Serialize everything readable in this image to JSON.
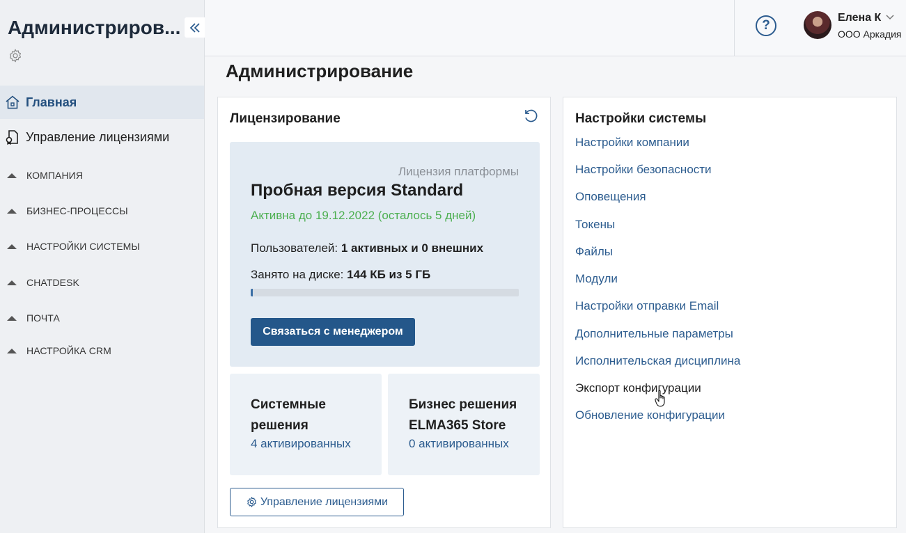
{
  "sidebar": {
    "title": "Администриров...",
    "nav": [
      {
        "label": "Главная",
        "icon": "home-icon",
        "active": true
      },
      {
        "label": "Управление лицензиями",
        "icon": "license-icon",
        "active": false
      }
    ],
    "sections": [
      {
        "label": "КОМПАНИЯ"
      },
      {
        "label": "БИЗНЕС-ПРОЦЕССЫ"
      },
      {
        "label": "НАСТРОЙКИ СИСТЕМЫ"
      },
      {
        "label": "CHATDESK"
      },
      {
        "label": "ПОЧТА"
      },
      {
        "label": "НАСТРОЙКА CRM"
      }
    ]
  },
  "header": {
    "help_glyph": "?",
    "user": {
      "name": "Елена К",
      "org": "ООО Аркадия"
    }
  },
  "main": {
    "page_title": "Администрирование",
    "licensing": {
      "title": "Лицензирование",
      "platform_label": "Лицензия платформы",
      "plan": "Пробная версия Standard",
      "active_until": "Активна до 19.12.2022 (осталось 5 дней)",
      "users_label": "Пользователей:",
      "users_value": "1 активных и 0 внешних",
      "disk_label": "Занято на диске:",
      "disk_value": "144 КБ из 5 ГБ",
      "disk_usage_fraction": 0.005,
      "contact_button": "Связаться с менеджером",
      "tiles": [
        {
          "title": "Системные решения",
          "link": "4 активированных"
        },
        {
          "title": "Бизнес решения ELMA365 Store",
          "link": "0 активированных"
        }
      ],
      "manage_button": "Управление лицензиями"
    },
    "system_settings": {
      "title": "Настройки системы",
      "links": [
        "Настройки компании",
        "Настройки безопасности",
        "Оповещения",
        "Токены",
        "Файлы",
        "Модули",
        "Настройки отправки Email",
        "Дополнительные параметры",
        "Исполнительская дисциплина",
        "Экспорт конфигурации",
        "Обновление конфигурации"
      ]
    }
  },
  "colors": {
    "accent": "#2c5c8f",
    "button": "#24578a",
    "active_green": "#4caf50",
    "sidebar_bg": "#eef0f3"
  }
}
